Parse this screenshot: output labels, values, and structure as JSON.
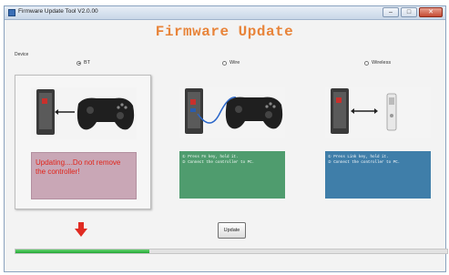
{
  "window": {
    "title": "Firmware Update Tool V2.0.00",
    "minimize_glyph": "–",
    "maximize_glyph": "□",
    "close_glyph": "✕"
  },
  "heading": "Firmware Update",
  "device": {
    "label": "Device",
    "options": [
      {
        "label": "BT",
        "selected": true
      },
      {
        "label": "Wire",
        "selected": false
      },
      {
        "label": "Wireless",
        "selected": false
      }
    ]
  },
  "panels": [
    {
      "image": "controller-bt-icon",
      "message_color": "#c9a7b6",
      "message": "Updating....Do not remove the controller!"
    },
    {
      "image": "controller-wire-icon",
      "message_color": "#4f9c6e",
      "lines": [
        "① Press Fn key, hold it.",
        "② Connect the controller to PC."
      ]
    },
    {
      "image": "dongle-wireless-icon",
      "message_color": "#3f7ea9",
      "lines": [
        "① Press Link key, hold it.",
        "② Connect the controller to PC."
      ]
    }
  ],
  "update_button": "Update",
  "arrow_icon": "down-arrow-icon",
  "progress": {
    "fraction": 0.31,
    "color": "#2fb441"
  }
}
